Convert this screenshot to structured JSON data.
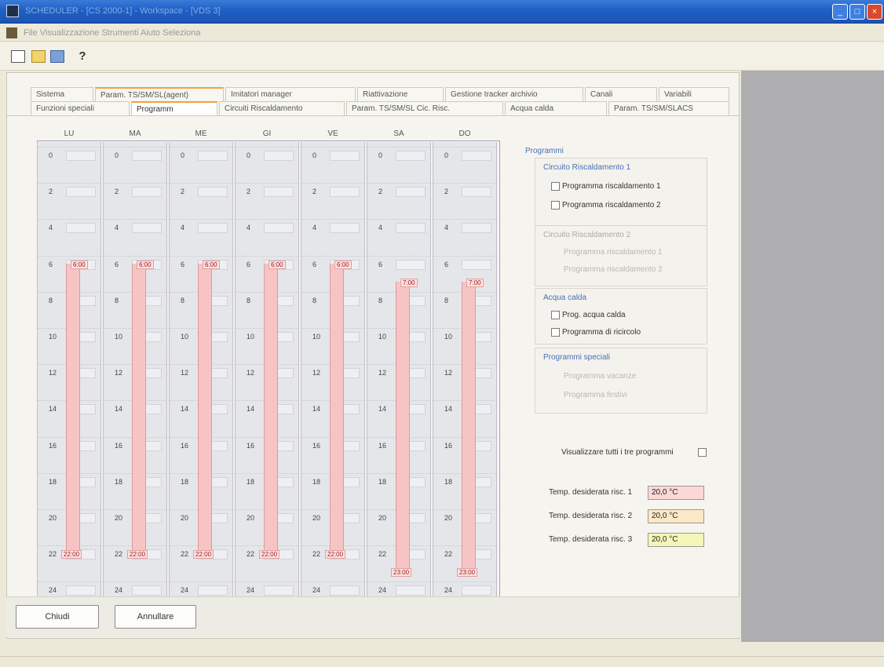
{
  "window": {
    "title": "SCHEDULER - [CS 2000-1] - Workspace - [VDS 3]",
    "buttons": [
      "_",
      "□",
      "×"
    ]
  },
  "menu": {
    "items": "File  Visualizzazione  Strumenti  Aiuto  Seleziona"
  },
  "toolbar": {
    "help_label": "?"
  },
  "tabs": {
    "row1": [
      "Sistema",
      "Param. TS/SM/SL(agent)",
      "Imitatori manager",
      "Riattivazione",
      "Gestione tracker archivio",
      "Canali",
      "Variabili"
    ],
    "row2": [
      "Funzioni speciali",
      "Programm",
      "Circuiti Riscaldamento",
      "Param. TS/SM/SL Cic. Risc.",
      "Acqua calda",
      "Param. TS/SM/SLACS"
    ]
  },
  "columns": [
    {
      "header": "LU",
      "ticks": [
        "0",
        "2",
        "4",
        "6",
        "8",
        "10",
        "12",
        "14",
        "16",
        "18",
        "20",
        "22",
        "24"
      ],
      "range_start": "6:00",
      "range_end": "22:00"
    },
    {
      "header": "MA",
      "ticks": [
        "0",
        "2",
        "4",
        "6",
        "8",
        "10",
        "12",
        "14",
        "16",
        "18",
        "20",
        "22",
        "24"
      ],
      "range_start": "6:00",
      "range_end": "22:00"
    },
    {
      "header": "ME",
      "ticks": [
        "0",
        "2",
        "4",
        "6",
        "8",
        "10",
        "12",
        "14",
        "16",
        "18",
        "20",
        "22",
        "24"
      ],
      "range_start": "6:00",
      "range_end": "22:00"
    },
    {
      "header": "GI",
      "ticks": [
        "0",
        "2",
        "4",
        "6",
        "8",
        "10",
        "12",
        "14",
        "16",
        "18",
        "20",
        "22",
        "24"
      ],
      "range_start": "6:00",
      "range_end": "22:00"
    },
    {
      "header": "VE",
      "ticks": [
        "0",
        "2",
        "4",
        "6",
        "8",
        "10",
        "12",
        "14",
        "16",
        "18",
        "20",
        "22",
        "24"
      ],
      "range_start": "6:00",
      "range_end": "22:00"
    },
    {
      "header": "SA",
      "ticks": [
        "0",
        "2",
        "4",
        "6",
        "8",
        "10",
        "12",
        "14",
        "16",
        "18",
        "20",
        "22",
        "24"
      ],
      "range_start": "7:00",
      "range_end": "23:00"
    },
    {
      "header": "DO",
      "ticks": [
        "0",
        "2",
        "4",
        "6",
        "8",
        "10",
        "12",
        "14",
        "16",
        "18",
        "20",
        "22",
        "24"
      ],
      "range_start": "7:00",
      "range_end": "23:00"
    }
  ],
  "options": {
    "group_title": "Programmi",
    "circuit1_title": "Circuito Riscaldamento 1",
    "circuit1_opts": [
      "Programma riscaldamento 1",
      "Programma riscaldamento 2"
    ],
    "circuit2_title": "Circuito Riscaldamento 2",
    "circuit2_opts": [
      "Programma riscaldamento 1",
      "Programma riscaldamento 2"
    ],
    "acqua_title": "Acqua calda",
    "acqua_opts": [
      "Prog. acqua calda",
      "Programma di ricircolo"
    ],
    "speciali_title": "Programmi speciali",
    "speciali_opts": [
      "Programma vacanze",
      "Programma festivi"
    ],
    "visualize_label": "Visualizzare tutti i tre programmi"
  },
  "values": [
    {
      "label": "Temp. desiderata risc. 1",
      "value": "20,0 °C",
      "color": "#fbd7d7"
    },
    {
      "label": "Temp. desiderata risc. 2",
      "value": "20,0 °C",
      "color": "#fbe8c6"
    },
    {
      "label": "Temp. desiderata risc. 3",
      "value": "20,0 °C",
      "color": "#f4f7b8"
    }
  ],
  "buttons": {
    "close_label": "Chiudi",
    "cancel_label": "Annullare"
  }
}
